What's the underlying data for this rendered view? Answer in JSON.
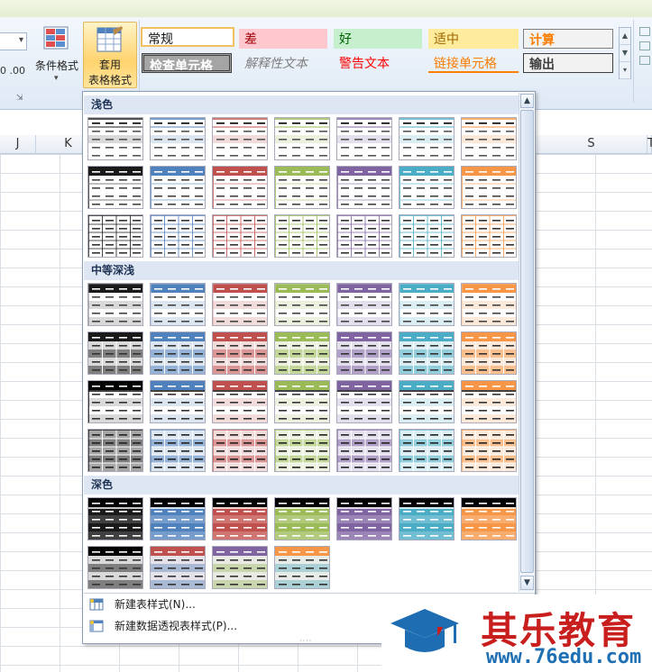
{
  "ribbon": {
    "small_label": "0 .00",
    "cond_format_label": "条件格式",
    "table_format_line1": "套用",
    "table_format_line2": "表格格式",
    "cell_styles": [
      {
        "key": "normal",
        "label": "常规"
      },
      {
        "key": "bad",
        "label": "差"
      },
      {
        "key": "good",
        "label": "好"
      },
      {
        "key": "neutral",
        "label": "适中"
      },
      {
        "key": "calc",
        "label": "计算"
      },
      {
        "key": "check",
        "label": "检查单元格"
      },
      {
        "key": "explain",
        "label": "解释性文本"
      },
      {
        "key": "warn",
        "label": "警告文本"
      },
      {
        "key": "link",
        "label": "链接单元格"
      },
      {
        "key": "output",
        "label": "输出"
      }
    ]
  },
  "columns": [
    {
      "label": "J"
    },
    {
      "label": "K"
    },
    {
      "label": "S"
    },
    {
      "label": "T"
    }
  ],
  "gallery": {
    "sections": [
      {
        "title": "浅色"
      },
      {
        "title": "中等深浅"
      },
      {
        "title": "深色"
      }
    ],
    "palette": [
      {
        "name": "black",
        "dark": "#1a1a1a",
        "mid": "#7f7f7f",
        "light": "#d9d9d9"
      },
      {
        "name": "blue",
        "dark": "#4f81bd",
        "mid": "#95b3d7",
        "light": "#dce6f1"
      },
      {
        "name": "red",
        "dark": "#c0504d",
        "mid": "#da9694",
        "light": "#f2dcdb"
      },
      {
        "name": "green",
        "dark": "#9bbb59",
        "mid": "#c4d79b",
        "light": "#ebf1de"
      },
      {
        "name": "purple",
        "dark": "#8064a2",
        "mid": "#b1a0c7",
        "light": "#e4dfec"
      },
      {
        "name": "aqua",
        "dark": "#4bacc6",
        "mid": "#92cddc",
        "light": "#daeef3"
      },
      {
        "name": "orange",
        "dark": "#f79646",
        "mid": "#fabf8f",
        "light": "#fde9d9"
      }
    ]
  },
  "menu": {
    "new_table_style": "新建表样式(N)...",
    "new_pivot_style": "新建数据透视表样式(P)..."
  },
  "watermark": {
    "brand": "其乐教育",
    "url": "www.76edu.com"
  }
}
